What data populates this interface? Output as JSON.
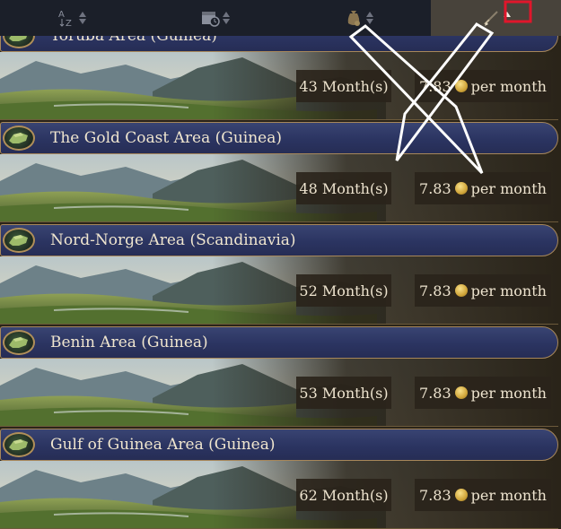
{
  "sort_bar": {
    "buttons": [
      {
        "id": "az",
        "icon": "az-sort-icon",
        "active": false
      },
      {
        "id": "duration",
        "icon": "calendar-clock-icon",
        "active": false
      },
      {
        "id": "cost",
        "icon": "money-bag-icon",
        "active": false
      },
      {
        "id": "distance",
        "icon": "compass-icon",
        "active": true
      }
    ],
    "active_direction": "ascending"
  },
  "colors": {
    "header_bg": "#2b3461",
    "header_border": "#a7875a",
    "text": "#eee4cf",
    "highlight": "#e0162b"
  },
  "rows": [
    {
      "name": "Yoruba Area (Guinea)",
      "duration": "43 Month(s)",
      "cost": "7.83",
      "cost_suffix": "per month"
    },
    {
      "name": "The Gold Coast Area (Guinea)",
      "duration": "48 Month(s)",
      "cost": "7.83",
      "cost_suffix": "per month"
    },
    {
      "name": "Nord-Norge Area (Scandinavia)",
      "duration": "52 Month(s)",
      "cost": "7.83",
      "cost_suffix": "per month"
    },
    {
      "name": "Benin Area (Guinea)",
      "duration": "53 Month(s)",
      "cost": "7.83",
      "cost_suffix": "per month"
    },
    {
      "name": "Gulf of Guinea Area (Guinea)",
      "duration": "62 Month(s)",
      "cost": "7.83",
      "cost_suffix": "per month"
    }
  ]
}
